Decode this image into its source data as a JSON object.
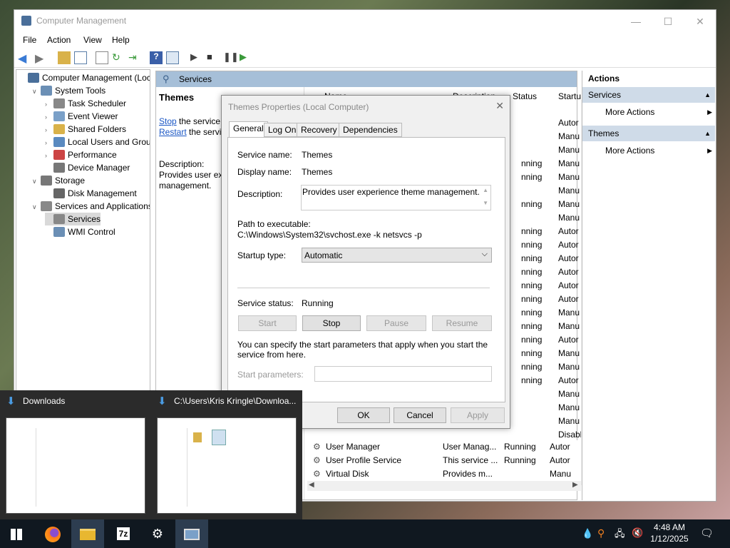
{
  "window": {
    "title": "Computer Management",
    "minimize": "—",
    "maximize": "☐",
    "close": "✕"
  },
  "menu": [
    "File",
    "Action",
    "View",
    "Help"
  ],
  "tree": [
    {
      "label": "Computer Management (Local",
      "level": 0,
      "exp": "",
      "color": "#4a6f9a"
    },
    {
      "label": "System Tools",
      "level": 1,
      "exp": "∨",
      "color": "#6b8fb5"
    },
    {
      "label": "Task Scheduler",
      "level": 2,
      "exp": "›",
      "color": "#888"
    },
    {
      "label": "Event Viewer",
      "level": 2,
      "exp": "›",
      "color": "#7aa0c8"
    },
    {
      "label": "Shared Folders",
      "level": 2,
      "exp": "›",
      "color": "#d9b24a"
    },
    {
      "label": "Local Users and Groups",
      "level": 2,
      "exp": "›",
      "color": "#5a8ac0"
    },
    {
      "label": "Performance",
      "level": 2,
      "exp": "›",
      "color": "#c44"
    },
    {
      "label": "Device Manager",
      "level": 2,
      "exp": "",
      "color": "#777"
    },
    {
      "label": "Storage",
      "level": 1,
      "exp": "∨",
      "color": "#777"
    },
    {
      "label": "Disk Management",
      "level": 2,
      "exp": "",
      "color": "#666"
    },
    {
      "label": "Services and Applications",
      "level": 1,
      "exp": "∨",
      "color": "#888"
    },
    {
      "label": "Services",
      "level": 2,
      "exp": "",
      "color": "#888",
      "selected": true
    },
    {
      "label": "WMI Control",
      "level": 2,
      "exp": "",
      "color": "#6b8fb5"
    }
  ],
  "center": {
    "header": "Services",
    "selected_name": "Themes",
    "stop_link": "Stop",
    "stop_rest": " the service",
    "restart_link": "Restart",
    "restart_rest": " the servic",
    "desc_label": "Description:",
    "desc_line1": "Provides user exp",
    "desc_line2": "management.",
    "col_name": "Name",
    "col_desc": "Description",
    "col_status": "Status",
    "col_startup": "Startu",
    "status_col": [
      "",
      "",
      "",
      "nning",
      "nning",
      "",
      "nning",
      "",
      "nning",
      "nning",
      "nning",
      "nning",
      "nning",
      "nning",
      "nning",
      "nning",
      "nning",
      "nning",
      "nning",
      "nning",
      "",
      "",
      "",
      ""
    ],
    "startup_col": [
      "Autor",
      "Manu",
      "Manu",
      "Manu",
      "Manu",
      "Manu",
      "Manu",
      "Manu",
      "Autor",
      "Autor",
      "Autor",
      "Autor",
      "Autor",
      "Autor",
      "Manu",
      "Manu",
      "Autor",
      "Manu",
      "Manu",
      "Autor",
      "Manu",
      "Manu",
      "Manu",
      "Disabl"
    ],
    "bottom_rows": [
      {
        "name": "User Manager",
        "desc": "User Manag...",
        "status": "Running",
        "startup": "Autor"
      },
      {
        "name": "User Profile Service",
        "desc": "This service ...",
        "status": "Running",
        "startup": "Autor"
      },
      {
        "name": "Virtual Disk",
        "desc": "Provides m...",
        "status": "",
        "startup": "Manu"
      }
    ]
  },
  "actions": {
    "title": "Actions",
    "group1": "Services",
    "group1_item": "More Actions",
    "group2": "Themes",
    "group2_item": "More Actions"
  },
  "dialog": {
    "title": "Themes Properties (Local Computer)",
    "tabs": [
      "General",
      "Log On",
      "Recovery",
      "Dependencies"
    ],
    "service_name_label": "Service name:",
    "service_name": "Themes",
    "display_name_label": "Display name:",
    "display_name": "Themes",
    "description_label": "Description:",
    "description": "Provides user experience theme management.",
    "path_label": "Path to executable:",
    "path": "C:\\Windows\\System32\\svchost.exe -k netsvcs -p",
    "startup_label": "Startup type:",
    "startup_value": "Automatic",
    "status_label": "Service status:",
    "status_value": "Running",
    "btn_start": "Start",
    "btn_stop": "Stop",
    "btn_pause": "Pause",
    "btn_resume": "Resume",
    "params_hint": "You can specify the start parameters that apply when you start the service from here.",
    "params_label": "Start parameters:",
    "btn_ok": "OK",
    "btn_cancel": "Cancel",
    "btn_apply": "Apply"
  },
  "thumbs": [
    {
      "title": "Downloads"
    },
    {
      "title": "C:\\Users\\Kris Kringle\\Downloa..."
    }
  ],
  "taskbar": {
    "time": "4:48 AM",
    "date": "1/12/2025",
    "app_7z": "7z"
  }
}
